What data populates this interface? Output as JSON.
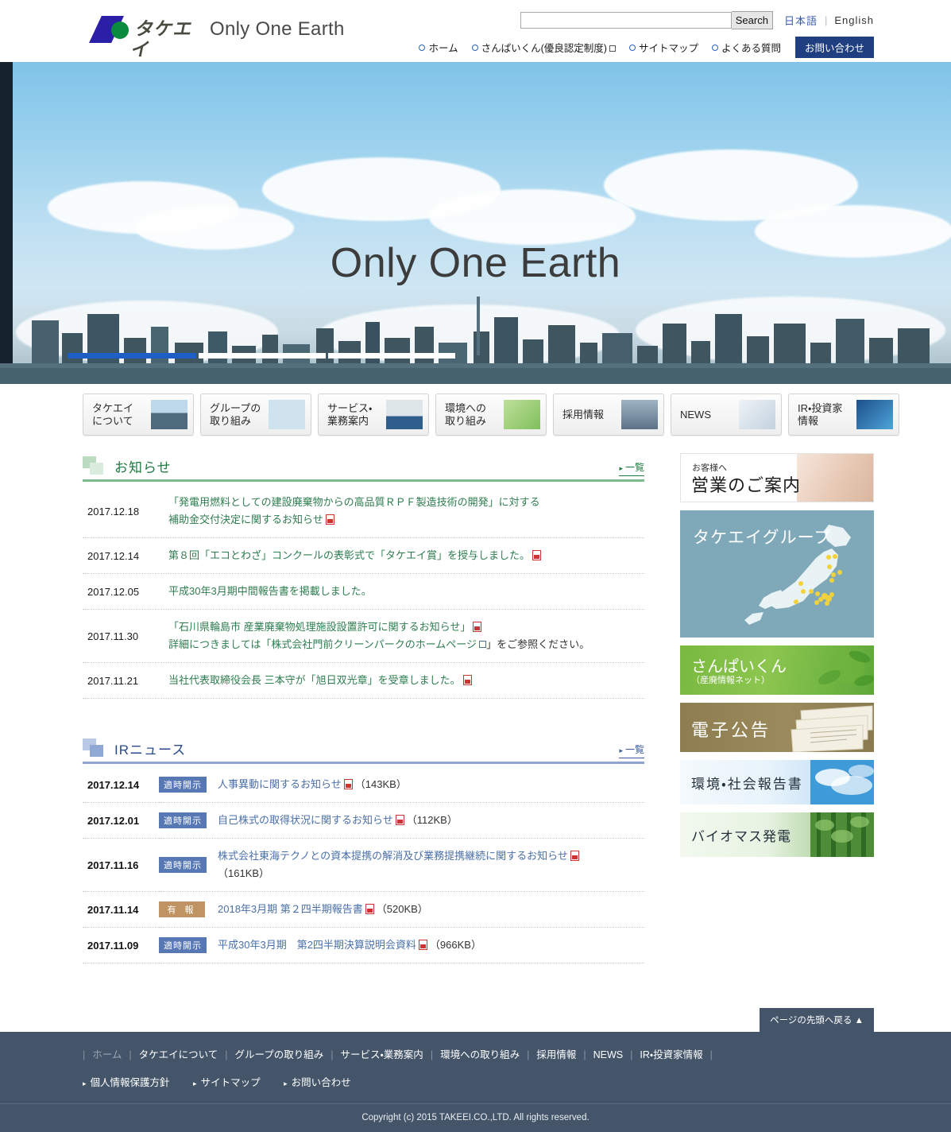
{
  "header": {
    "logo_kana": "タケエイ",
    "tagline": "Only One Earth",
    "search_placeholder": "",
    "search_value": "",
    "search_button": "Search",
    "lang_ja": "日本語",
    "lang_sep": "|",
    "lang_en": "English",
    "nav": [
      {
        "label": "ホーム",
        "external": false
      },
      {
        "label": "さんぱいくん(優良認定制度)",
        "external": true
      },
      {
        "label": "サイトマップ",
        "external": false
      },
      {
        "label": "よくある質問",
        "external": false
      }
    ],
    "contact_button": "お問い合わせ"
  },
  "hero": {
    "title": "Only One Earth"
  },
  "gnav": [
    {
      "label_line1": "タケエイ",
      "label_line2": "について",
      "thumb": "city-thumb"
    },
    {
      "label_line1": "グループの",
      "label_line2": "取り組み",
      "thumb": "japan-map-thumb"
    },
    {
      "label_line1": "サービス・",
      "label_line2": "業務案内",
      "thumb": "truck-thumb"
    },
    {
      "label_line1": "環境への",
      "label_line2": "取り組み",
      "thumb": "hand-leaf-thumb"
    },
    {
      "label_line1": "採用情報",
      "label_line2": "",
      "thumb": "team-thumb"
    },
    {
      "label_line1": "NEWS",
      "label_line2": "",
      "thumb": "notebook-thumb"
    },
    {
      "label_line1": "IR・投資家",
      "label_line2": "情報",
      "thumb": "globe-data-thumb"
    }
  ],
  "news": {
    "title": "お知らせ",
    "more_label": "一覧",
    "more_arrow": "▸",
    "items": [
      {
        "date": "2017.12.18",
        "lines": [
          {
            "text": "「発電用燃料としての建設廃棄物からの高品質ＲＰＦ製造技術の開発」に対する",
            "pdf": false,
            "ext": false
          },
          {
            "text": "補助金交付決定に関するお知らせ",
            "pdf": true,
            "ext": false
          }
        ]
      },
      {
        "date": "2017.12.14",
        "lines": [
          {
            "text": "第８回「エコとわざ」コンクールの表彰式で「タケエイ賞」を授与しました。",
            "pdf": true,
            "ext": false
          }
        ]
      },
      {
        "date": "2017.12.05",
        "lines": [
          {
            "text": "平成30年3月期中間報告書を掲載しました。",
            "pdf": false,
            "ext": false
          }
        ]
      },
      {
        "date": "2017.11.30",
        "lines": [
          {
            "text": "「石川県輪島市 産業廃棄物処理施設設置許可に関するお知らせ」",
            "pdf": true,
            "ext": false
          },
          {
            "text": "詳細につきましては「株式会社門前クリーンパークのホームページ",
            "suffix": "」をご参照ください。",
            "pdf": false,
            "ext": true
          }
        ]
      },
      {
        "date": "2017.11.21",
        "lines": [
          {
            "text": "当社代表取締役会長 三本守が「旭日双光章」を受章しました。",
            "pdf": true,
            "ext": false
          }
        ]
      }
    ]
  },
  "ir": {
    "title": "IRニュース",
    "more_label": "一覧",
    "more_arrow": "▸",
    "items": [
      {
        "date": "2017.12.14",
        "badge": "適時開示",
        "badge_type": "disclosure",
        "text": "人事異動に関するお知らせ",
        "size": "（143KB）",
        "pdf": true
      },
      {
        "date": "2017.12.01",
        "badge": "適時開示",
        "badge_type": "disclosure",
        "text": "自己株式の取得状況に関するお知らせ",
        "size": "（112KB）",
        "pdf": true
      },
      {
        "date": "2017.11.16",
        "badge": "適時開示",
        "badge_type": "disclosure",
        "text": "株式会社東海テクノとの資本提携の解消及び業務提携継続に関するお知らせ",
        "size": "（161KB）",
        "pdf": true
      },
      {
        "date": "2017.11.14",
        "badge": "有 報",
        "badge_type": "yuho",
        "text": "2018年3月期 第２四半期報告書",
        "size": "（520KB）",
        "pdf": true
      },
      {
        "date": "2017.11.09",
        "badge": "適時開示",
        "badge_type": "disclosure",
        "text": "平成30年3月期　第2四半期決算説明会資料",
        "size": "（966KB）",
        "pdf": true
      }
    ]
  },
  "sidebar": {
    "banners": [
      {
        "name": "sales-guide",
        "kicker": "お客様へ",
        "title": "営業のご案内"
      },
      {
        "name": "takeei-group",
        "kicker": "",
        "title": "タケエイグループ"
      },
      {
        "name": "sanpai-kun",
        "kicker": "",
        "title": "さんぱいくん",
        "sub": "（産廃情報ネット）"
      },
      {
        "name": "electronic-notice",
        "kicker": "",
        "title": "電子公告"
      },
      {
        "name": "env-social-report",
        "kicker": "",
        "title": "環境・社会報告書"
      },
      {
        "name": "biomass-power",
        "kicker": "",
        "title": "バイオマス発電"
      }
    ]
  },
  "footer": {
    "pagetop_label": "ページの先頭へ戻る",
    "pagetop_arrow": "▲",
    "nav": [
      {
        "label": "ホーム",
        "current": true
      },
      {
        "label": "タケエイについて",
        "current": false
      },
      {
        "label": "グループの取り組み",
        "current": false
      },
      {
        "label": "サービス・業務案内",
        "current": false
      },
      {
        "label": "環境への取り組み",
        "current": false
      },
      {
        "label": "採用情報",
        "current": false
      },
      {
        "label": "NEWS",
        "current": false
      },
      {
        "label": "IR・投資家情報",
        "current": false
      }
    ],
    "sub_nav": [
      {
        "label": "個人情報保護方針"
      },
      {
        "label": "サイトマップ"
      },
      {
        "label": "お問い合わせ"
      }
    ],
    "sub_arrow": "▸",
    "copyright": "Copyright (c) 2015 TAKEEI.CO.,LTD. All rights reserved."
  },
  "colors": {
    "news_green": "#1f7a3f",
    "ir_blue": "#2a4a8c",
    "contact_navy": "#1f3f80",
    "footer_slate": "#44556a",
    "badge_blue": "#5878b4",
    "badge_brown": "#c09462"
  }
}
